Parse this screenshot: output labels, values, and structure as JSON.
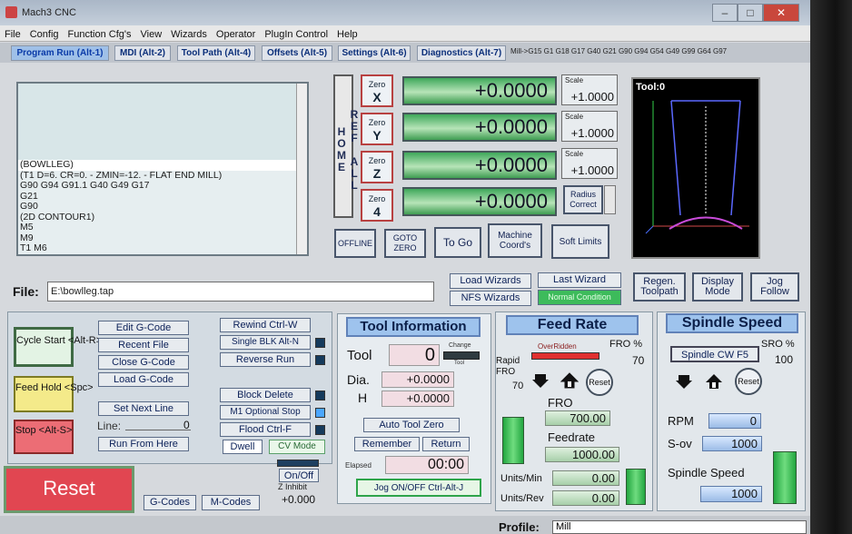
{
  "window": {
    "title": "Mach3 CNC"
  },
  "menu": [
    "File",
    "Config",
    "Function Cfg's",
    "View",
    "Wizards",
    "Operator",
    "PlugIn Control",
    "Help"
  ],
  "tabs": [
    {
      "label": "Program Run (Alt-1)",
      "active": true
    },
    {
      "label": "MDI (Alt-2)",
      "active": false
    },
    {
      "label": "Tool Path (Alt-4)",
      "active": false
    },
    {
      "label": "Offsets (Alt-5)",
      "active": false
    },
    {
      "label": "Settings (Alt-6)",
      "active": false
    },
    {
      "label": "Diagnostics (Alt-7)",
      "active": false
    }
  ],
  "modal_codes": "Mill->G15  G1 G18 G17 G40 G21 G90 G94 G54 G49 G99 G64 G97",
  "gcode": {
    "lines": [
      "(BOWLLEG)",
      "(T1  D=6. CR=0. - ZMIN=-12. - FLAT END MILL)",
      "G90 G94 G91.1 G40 G49 G17",
      "G21",
      "G90",
      "(2D CONTOUR1)",
      "M5",
      "M9",
      "T1 M6"
    ]
  },
  "dro": {
    "ref_all_home": "REF ALL HOME",
    "axes": [
      {
        "zero": "Zero",
        "axis": "X",
        "value": "+0.0000",
        "scale_label": "Scale",
        "scale": "+1.0000"
      },
      {
        "zero": "Zero",
        "axis": "Y",
        "value": "+0.0000",
        "scale_label": "Scale",
        "scale": "+1.0000"
      },
      {
        "zero": "Zero",
        "axis": "Z",
        "value": "+0.0000",
        "scale_label": "Scale",
        "scale": "+1.0000"
      },
      {
        "zero": "Zero",
        "axis": "4",
        "value": "+0.0000"
      }
    ],
    "radius_correct": "Radius Correct",
    "buttons": {
      "offline": "OFFLINE",
      "goto_zero": "GOTO ZERO",
      "to_go": "To Go",
      "machine_coords": "Machine Coord's",
      "soft_limits": "Soft Limits"
    }
  },
  "toolpath": {
    "label": "Tool:0"
  },
  "toolpath_buttons": {
    "regen": "Regen. Toolpath",
    "display_mode": "Display Mode",
    "jog_follow": "Jog Follow"
  },
  "file": {
    "label": "File:",
    "path": "E:\\bowlleg.tap"
  },
  "wizards": {
    "load": "Load Wizards",
    "last": "Last Wizard",
    "nfs": "NFS Wizards",
    "normal": "Normal Condition"
  },
  "program": {
    "cycle_start": "Cycle Start <Alt-R>",
    "feed_hold": "Feed Hold <Spc>",
    "stop": "Stop <Alt-S>",
    "reset": "Reset",
    "edit": "Edit G-Code",
    "recent": "Recent File",
    "close": "Close G-Code",
    "load": "Load G-Code",
    "set_next": "Set Next Line",
    "line_label": "Line:",
    "line_value": "0",
    "run_from_here": "Run From Here",
    "rewind": "Rewind Ctrl-W",
    "single_blk": "Single BLK Alt-N",
    "reverse_run": "Reverse Run",
    "block_delete": "Block Delete",
    "m1_stop": "M1 Optional Stop",
    "flood": "Flood Ctrl-F",
    "dwell": "Dwell",
    "cv_mode": "CV Mode",
    "onoff": "On/Off",
    "z_inhibit": "Z Inhibit",
    "z_value": "+0.000",
    "gcodes": "G-Codes",
    "mcodes": "M-Codes"
  },
  "tool_info": {
    "header": "Tool Information",
    "tool_label": "Tool",
    "tool_value": "0",
    "change": "Change",
    "tool_led": "Tool",
    "dia_label": "Dia.",
    "dia_value": "+0.0000",
    "h_label": "H",
    "h_value": "+0.0000",
    "auto_zero": "Auto Tool Zero",
    "remember": "Remember",
    "return": "Return",
    "elapsed_label": "Elapsed",
    "elapsed_value": "00:00",
    "jog": "Jog ON/OFF Ctrl-Alt-J"
  },
  "feed": {
    "header": "Feed Rate",
    "overridden": "OverRidden",
    "fro_pct_label": "FRO %",
    "fro_pct": "70",
    "rapid_label": "Rapid FRO",
    "rapid_value": "70",
    "reset": "Reset",
    "fro_label": "FRO",
    "fro_value": "700.00",
    "feedrate_label": "Feedrate",
    "feedrate_value": "1000.00",
    "units_min_label": "Units/Min",
    "units_min_value": "0.00",
    "units_rev_label": "Units/Rev",
    "units_rev_value": "0.00"
  },
  "spindle": {
    "header": "Spindle Speed",
    "cw": "Spindle CW F5",
    "sro_label": "SRO %",
    "sro_value": "100",
    "reset": "Reset",
    "rpm_label": "RPM",
    "rpm_value": "0",
    "sov_label": "S-ov",
    "sov_value": "1000",
    "speed_label": "Spindle Speed",
    "speed_value": "1000"
  },
  "status": {
    "profile_label": "Profile:",
    "profile_value": "Mill"
  }
}
